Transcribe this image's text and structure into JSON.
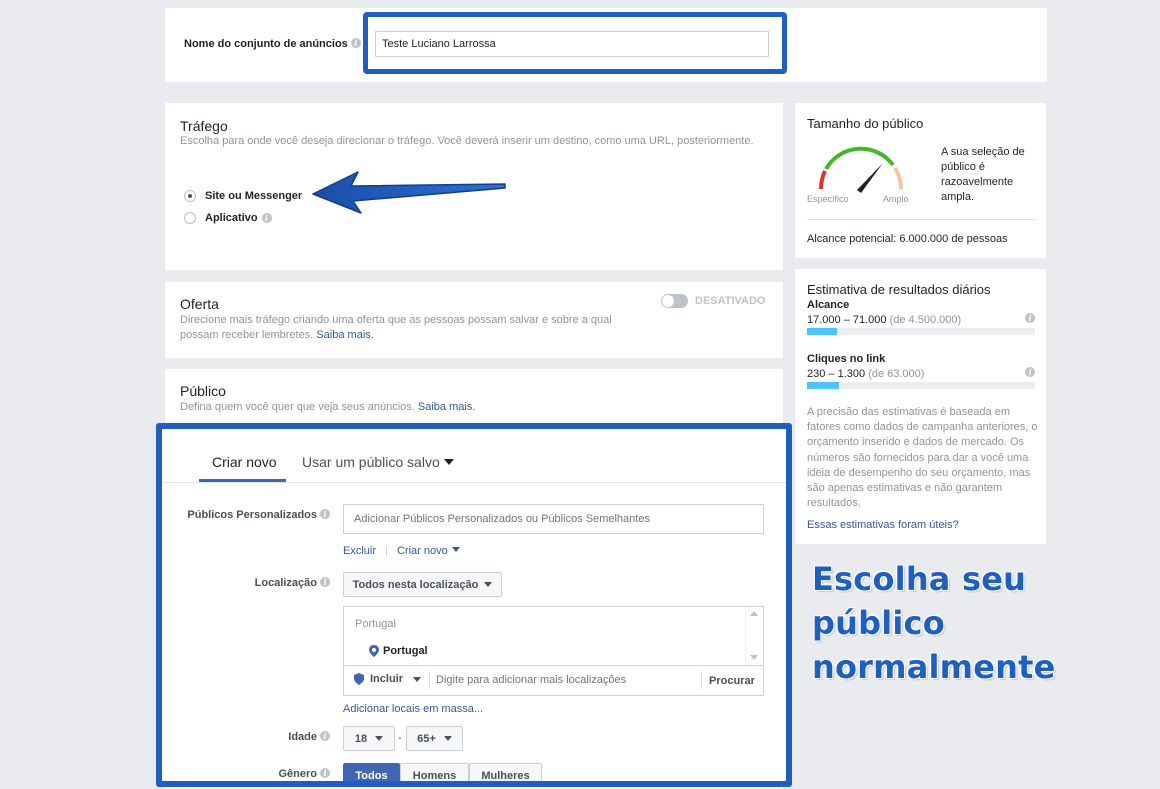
{
  "ad_set_name": {
    "label": "Nome do conjunto de anúncios",
    "value": "Teste Luciano Larrossa"
  },
  "traffic": {
    "title": "Tráfego",
    "description": "Escolha para onde você deseja direcionar o tráfego. Você deverá inserir um destino, como uma URL, posteriormente.",
    "options": [
      {
        "label": "Site ou Messenger",
        "selected": true
      },
      {
        "label": "Aplicativo",
        "selected": false
      }
    ]
  },
  "offer": {
    "title": "Oferta",
    "description": "Direcione mais tráfego criando uma oferta que as pessoas possam salvar e sobre a qual possam receber lembretes.",
    "learn_more": "Saiba mais.",
    "toggle_label": "DESATIVADO",
    "enabled": false
  },
  "audience": {
    "title": "Público",
    "description": "Defina quem você quer que veja seus anúncios.",
    "learn_more": "Saiba mais.",
    "tabs": [
      {
        "label": "Criar novo",
        "active": true
      },
      {
        "label": "Usar um público salvo",
        "active": false
      }
    ],
    "custom_audiences": {
      "label": "Públicos Personalizados",
      "placeholder": "Adicionar Públicos Personalizados ou Públicos Semelhantes",
      "exclude": "Excluir",
      "create_new": "Criar novo"
    },
    "location": {
      "label": "Localização",
      "dropdown": "Todos nesta localização",
      "group_header": "Portugal",
      "selected": "Portugal",
      "include": "Incluir",
      "placeholder": "Digite para adicionar mais localizações",
      "browse": "Procurar",
      "bulk_add": "Adicionar locais em massa..."
    },
    "age": {
      "label": "Idade",
      "min": "18",
      "separator": "-",
      "max": "65+"
    },
    "gender": {
      "label": "Gênero",
      "options": [
        "Todos",
        "Homens",
        "Mulheres"
      ]
    }
  },
  "audience_size": {
    "title": "Tamanho do público",
    "gauge_min_label": "Específico",
    "gauge_max_label": "Amplo",
    "summary": "A sua seleção de público é razoavelmente ampla.",
    "potential_reach": "Alcance potencial: 6.000.000 de pessoas"
  },
  "daily_estimate": {
    "title": "Estimativa de resultados diários",
    "metrics": [
      {
        "label": "Alcance",
        "range": "17.000 – 71.000",
        "total": "(de 4.500.000)",
        "fill_fraction": 0.13
      },
      {
        "label": "Cliques no link",
        "range": "230 – 1.300",
        "total": "(de 63.000)",
        "fill_fraction": 0.14
      }
    ],
    "disclaimer": "A precisão das estimativas é baseada em fatores como dados de campanha anteriores, o orçamento inserido e dados de mercado. Os números são fornecidos para dar a você uma ideia de desempenho do seu orçamento, mas são apenas estimativas e não garantem resultados.",
    "feedback_link": "Essas estimativas foram úteis?"
  },
  "overlay": {
    "line1": "Escolha seu público",
    "line2": "normalmente"
  },
  "colors": {
    "highlight": "#1f5fbf",
    "link": "#365899",
    "bar": "#4fc3f7",
    "gauge_green": "#42b72a",
    "gauge_red": "#e02f2f",
    "gauge_orange": "#f7c4a2"
  }
}
